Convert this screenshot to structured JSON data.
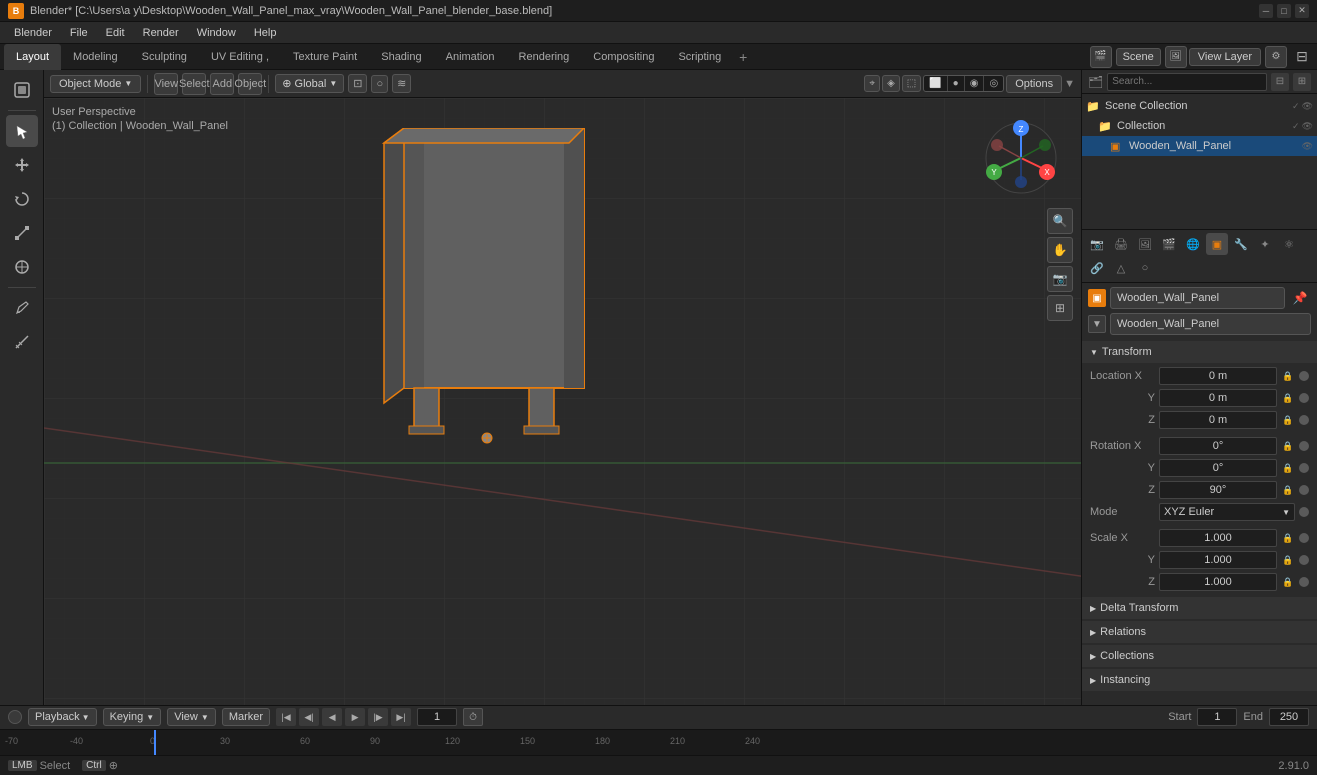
{
  "window": {
    "title": "Blender* [C:\\Users\\a y\\Desktop\\Wooden_Wall_Panel_max_vray\\Wooden_Wall_Panel_blender_base.blend]",
    "icon": "B"
  },
  "menu": {
    "items": [
      "Blender",
      "File",
      "Edit",
      "Render",
      "Window",
      "Help"
    ]
  },
  "workspace_tabs": {
    "tabs": [
      "Layout",
      "Modeling",
      "Sculpting",
      "UV Editing ,",
      "Texture Paint",
      "Shading",
      "Animation",
      "Rendering",
      "Compositing",
      "Scripting"
    ],
    "active": "Layout",
    "plus_label": "+",
    "scene": "Scene",
    "view_layer": "View Layer"
  },
  "viewport_header": {
    "mode": "Object Mode",
    "view_label": "View",
    "select_label": "Select",
    "add_label": "Add",
    "object_label": "Object",
    "sync_icon": "⟳",
    "transform": "Global",
    "snap_icon": "⊡",
    "options_label": "Options"
  },
  "viewport_info": {
    "perspective": "User Perspective",
    "collection": "(1) Collection | Wooden_Wall_Panel"
  },
  "outliner": {
    "search_placeholder": "Search...",
    "scene_collection": "Scene Collection",
    "collection": "Collection",
    "object": "Wooden_Wall_Panel"
  },
  "properties": {
    "object_name": "Wooden_Wall_Panel",
    "object_data_name": "Wooden_Wall_Panel",
    "transform_label": "Transform",
    "location": {
      "x_label": "X",
      "y_label": "Y",
      "z_label": "Z",
      "x_val": "0 m",
      "y_val": "0 m",
      "z_val": "0 m"
    },
    "rotation": {
      "x_label": "X",
      "y_label": "Y",
      "z_label": "Z",
      "x_val": "0°",
      "y_val": "0°",
      "z_val": "90°",
      "mode_label": "Mode",
      "mode_val": "XYZ Euler"
    },
    "scale": {
      "x_label": "X",
      "y_label": "Y",
      "z_label": "Z",
      "x_val": "1.000",
      "y_val": "1.000",
      "z_val": "1.000"
    },
    "delta_transform_label": "Delta Transform",
    "relations_label": "Relations",
    "collections_label": "Collections",
    "instancing_label": "Instancing"
  },
  "timeline": {
    "playback_label": "Playback",
    "keying_label": "Keying",
    "view_label": "View",
    "marker_label": "Marker",
    "current_frame": "1",
    "start_label": "Start",
    "start_val": "1",
    "end_label": "End",
    "end_val": "250"
  },
  "status_bar": {
    "select_label": "Select",
    "version": "2.91.0"
  },
  "icons": {
    "cursor": "⊕",
    "move": "✛",
    "rotate": "↻",
    "scale": "⤢",
    "transform": "⊞",
    "annotate": "✏",
    "measure": "📐",
    "search": "🔍",
    "camera": "📷",
    "grid": "⊞",
    "magnify": "🔍",
    "pan": "✋",
    "gizmo_x": "X",
    "gizmo_y": "Y",
    "gizmo_z": "Z"
  }
}
